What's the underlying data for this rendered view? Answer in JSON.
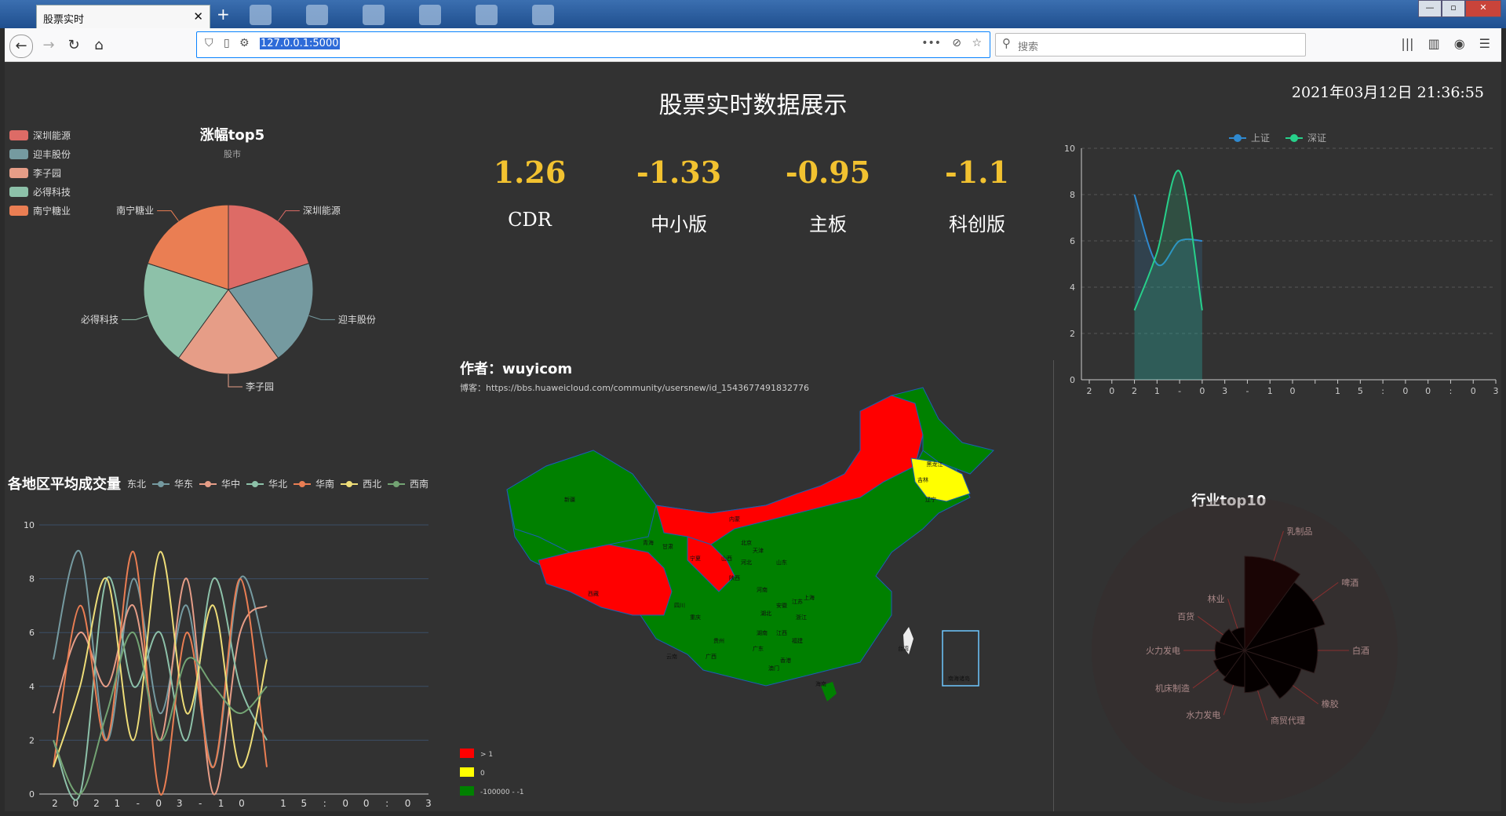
{
  "browser": {
    "tab_title": "股票实时",
    "url": "127.0.0.1:5000",
    "search_placeholder": "搜索"
  },
  "header": {
    "title": "股票实时数据展示",
    "datetime": "2021年03月12日 21:36:55"
  },
  "kpis": [
    {
      "value": "1.26",
      "label": "CDR"
    },
    {
      "value": "-1.33",
      "label": "中小版"
    },
    {
      "value": "-0.95",
      "label": "主板"
    },
    {
      "value": "-1.1",
      "label": "科创版"
    }
  ],
  "colors": {
    "bg": "#323232",
    "kpi": "#f2c230",
    "map_up": "#ff0000",
    "map_zero": "#ffff00",
    "map_down": "#008000"
  },
  "chart_data": [
    {
      "type": "pie",
      "title": "涨幅top5",
      "subtitle": "股市",
      "legend_position": "top-left",
      "slices": [
        {
          "name": "深圳能源",
          "value": 20,
          "color": "#dd6b66"
        },
        {
          "name": "迎丰股份",
          "value": 20,
          "color": "#759aa0"
        },
        {
          "name": "李子园",
          "value": 20,
          "color": "#e69d87"
        },
        {
          "name": "必得科技",
          "value": 20,
          "color": "#8dc1a9"
        },
        {
          "name": "南宁糖业",
          "value": 20,
          "color": "#ea7e53"
        }
      ]
    },
    {
      "type": "line",
      "title": "",
      "legend": [
        {
          "name": "上证",
          "color": "#2f89cf"
        },
        {
          "name": "深证",
          "color": "#27d08a"
        }
      ],
      "x_ticks": [
        "2",
        "0",
        "2",
        "1",
        "-",
        "0",
        "3",
        "-",
        "1",
        "0",
        "",
        "1",
        "5",
        ":",
        "0",
        "0",
        ":",
        "0",
        "3"
      ],
      "ylim": [
        0,
        10
      ],
      "yticks": [
        0,
        2,
        4,
        6,
        8,
        10
      ],
      "series": [
        {
          "name": "上证",
          "color": "#2f89cf",
          "points": [
            [
              2,
              8
            ],
            [
              3,
              5
            ],
            [
              4,
              6
            ],
            [
              5,
              6
            ]
          ]
        },
        {
          "name": "深证",
          "color": "#27d08a",
          "points": [
            [
              2,
              3
            ],
            [
              3,
              5.5
            ],
            [
              4,
              9
            ],
            [
              5,
              3
            ]
          ]
        }
      ]
    },
    {
      "type": "line",
      "title": "各地区平均成交量",
      "legend": [
        {
          "name": "东北",
          "color": "#dd6b66"
        },
        {
          "name": "华东",
          "color": "#759aa0"
        },
        {
          "name": "华中",
          "color": "#e69d87"
        },
        {
          "name": "华北",
          "color": "#8dc1a9"
        },
        {
          "name": "华南",
          "color": "#ea7e53"
        },
        {
          "name": "西北",
          "color": "#eedd78"
        },
        {
          "name": "西南",
          "color": "#73a373"
        }
      ],
      "x_ticks": [
        "2",
        "0",
        "2",
        "1",
        "-",
        "0",
        "3",
        "-",
        "1",
        "0",
        "",
        "1",
        "5",
        ":",
        "0",
        "0",
        ":",
        "0",
        "3"
      ],
      "ylim": [
        0,
        10
      ],
      "yticks": [
        0,
        2,
        4,
        6,
        8,
        10
      ],
      "series": [
        {
          "name": "华东",
          "color": "#759aa0",
          "points": [
            [
              0,
              5
            ],
            [
              1,
              9
            ],
            [
              2,
              2
            ],
            [
              3,
              8
            ],
            [
              4,
              3
            ],
            [
              5,
              7
            ],
            [
              6,
              1
            ],
            [
              7,
              8
            ],
            [
              8,
              5
            ]
          ]
        },
        {
          "name": "华中",
          "color": "#e69d87",
          "points": [
            [
              0,
              3
            ],
            [
              1,
              6
            ],
            [
              2,
              4
            ],
            [
              3,
              7
            ],
            [
              4,
              2
            ],
            [
              5,
              8
            ],
            [
              6,
              0
            ],
            [
              7,
              6
            ],
            [
              8,
              7
            ]
          ]
        },
        {
          "name": "华北",
          "color": "#8dc1a9",
          "points": [
            [
              0,
              2
            ],
            [
              1,
              0
            ],
            [
              2,
              8
            ],
            [
              3,
              4
            ],
            [
              4,
              6
            ],
            [
              5,
              2
            ],
            [
              6,
              8
            ],
            [
              7,
              4
            ],
            [
              8,
              2
            ]
          ]
        },
        {
          "name": "华南",
          "color": "#ea7e53",
          "points": [
            [
              0,
              1
            ],
            [
              1,
              7
            ],
            [
              2,
              2
            ],
            [
              3,
              9
            ],
            [
              4,
              0
            ],
            [
              5,
              6
            ],
            [
              6,
              1
            ],
            [
              7,
              8
            ],
            [
              8,
              1
            ]
          ]
        },
        {
          "name": "西北",
          "color": "#eedd78",
          "points": [
            [
              0,
              1
            ],
            [
              1,
              4
            ],
            [
              2,
              8
            ],
            [
              3,
              2
            ],
            [
              4,
              9
            ],
            [
              5,
              3
            ],
            [
              6,
              7
            ],
            [
              7,
              1
            ],
            [
              8,
              5
            ]
          ]
        },
        {
          "name": "西南",
          "color": "#73a373",
          "points": [
            [
              0,
              2
            ],
            [
              1,
              0
            ],
            [
              2,
              3
            ],
            [
              3,
              6
            ],
            [
              4,
              2
            ],
            [
              5,
              5
            ],
            [
              6,
              4
            ],
            [
              7,
              3
            ],
            [
              8,
              4
            ]
          ]
        }
      ]
    },
    {
      "type": "map",
      "title": "作者：wuyicom",
      "subtitle": "博客：https://bbs.huaweicloud.com/community/usersnew/id_1543677491832776",
      "legend": [
        {
          "label": "> 1",
          "color": "#ff0000"
        },
        {
          "label": "0",
          "color": "#ffff00"
        },
        {
          "label": "-100000 - -1",
          "color": "#008000"
        }
      ],
      "labels": [
        "新疆",
        "西藏",
        "青海",
        "甘肃",
        "内蒙",
        "黑龙江",
        "吉林",
        "辽宁",
        "北京",
        "天津",
        "河北",
        "山西",
        "山东",
        "陕西",
        "河南",
        "四川",
        "重庆",
        "湖北",
        "安徽",
        "江苏",
        "上海",
        "浙江",
        "湖南",
        "江西",
        "贵州",
        "云南",
        "广西",
        "广东",
        "福建",
        "台湾",
        "海南",
        "香港",
        "澳门",
        "宁夏",
        "南海诸岛"
      ]
    },
    {
      "type": "pie",
      "title": "行业top10",
      "roseType": "area",
      "slices": [
        {
          "name": "乳制品",
          "value": 10
        },
        {
          "name": "啤酒",
          "value": 8
        },
        {
          "name": "白酒",
          "value": 6
        },
        {
          "name": "橡胶",
          "value": 4
        },
        {
          "name": "商贸代理",
          "value": 2
        },
        {
          "name": "水力发电",
          "value": 1.5
        },
        {
          "name": "机床制造",
          "value": 1.2
        },
        {
          "name": "火力发电",
          "value": 1
        },
        {
          "name": "百货",
          "value": 0.8
        },
        {
          "name": "林业",
          "value": 0.6
        }
      ]
    }
  ]
}
